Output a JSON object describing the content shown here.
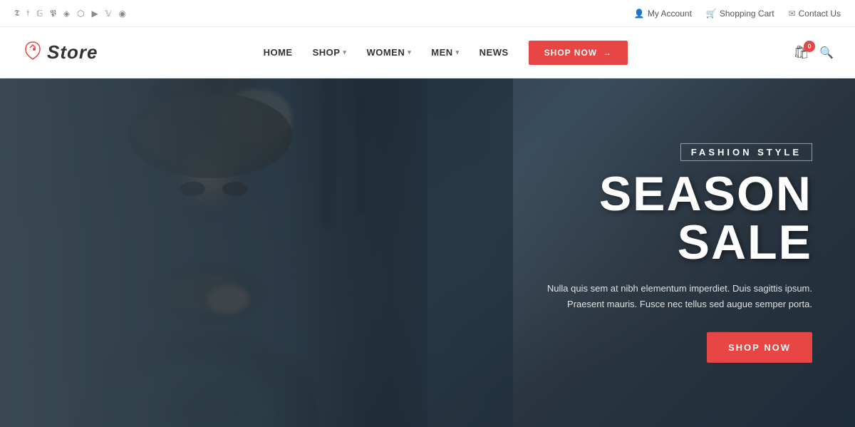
{
  "topbar": {
    "social_icons": [
      {
        "name": "twitter-icon",
        "symbol": "𝕋",
        "unicode": "t",
        "label": "Twitter"
      },
      {
        "name": "facebook-icon",
        "symbol": "f",
        "label": "Facebook"
      },
      {
        "name": "google-plus-icon",
        "symbol": "G+",
        "label": "Google Plus"
      },
      {
        "name": "pinterest-icon",
        "symbol": "P",
        "label": "Pinterest"
      },
      {
        "name": "instagram2-icon",
        "symbol": "◈",
        "label": "Instagram"
      },
      {
        "name": "instagram-icon",
        "symbol": "⬡",
        "label": "Camera"
      },
      {
        "name": "youtube-icon",
        "symbol": "▶",
        "label": "YouTube"
      },
      {
        "name": "vimeo-icon",
        "symbol": "V",
        "label": "Vimeo"
      },
      {
        "name": "rss-icon",
        "symbol": "◉",
        "label": "RSS"
      }
    ],
    "links": [
      {
        "name": "my-account-link",
        "label": "My Account",
        "icon": "👤"
      },
      {
        "name": "shopping-cart-link",
        "label": "Shopping Cart",
        "icon": "🛒"
      },
      {
        "name": "contact-us-link",
        "label": "Contact Us",
        "icon": "✉"
      }
    ]
  },
  "header": {
    "logo_text": "Store",
    "nav_items": [
      {
        "label": "HOME",
        "has_dropdown": false
      },
      {
        "label": "SHOP",
        "has_dropdown": true
      },
      {
        "label": "WOMEN",
        "has_dropdown": true
      },
      {
        "label": "MEN",
        "has_dropdown": true
      },
      {
        "label": "NEWS",
        "has_dropdown": false
      }
    ],
    "shop_now_button": "SHOP NOW",
    "cart_count": "0"
  },
  "hero": {
    "subtitle": "FASHION STYLE",
    "title": "SEASON SALE",
    "description_line1": "Nulla quis sem at nibh elementum imperdiet. Duis sagittis ipsum.",
    "description_line2": "Praesent mauris. Fusce nec tellus sed augue semper porta.",
    "button_label": "SHOP NOW"
  },
  "colors": {
    "accent": "#e84545",
    "nav_text": "#333333",
    "hero_bg": "#2a3a4a"
  }
}
